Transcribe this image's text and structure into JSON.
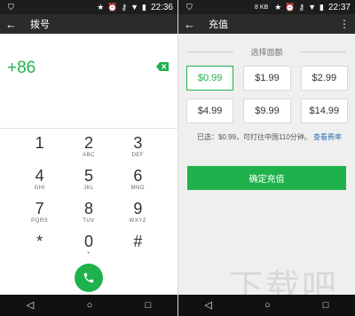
{
  "left": {
    "status": {
      "time": "22:36"
    },
    "appbar": {
      "title": "拨号"
    },
    "number": "+86",
    "keys": [
      {
        "d": "1",
        "l": ""
      },
      {
        "d": "2",
        "l": "ABC"
      },
      {
        "d": "3",
        "l": "DEF"
      },
      {
        "d": "4",
        "l": "GHI"
      },
      {
        "d": "5",
        "l": "JKL"
      },
      {
        "d": "6",
        "l": "MNO"
      },
      {
        "d": "7",
        "l": "PQRS"
      },
      {
        "d": "8",
        "l": "TUV"
      },
      {
        "d": "9",
        "l": "WXYZ"
      },
      {
        "d": "*",
        "l": ""
      },
      {
        "d": "0",
        "l": "+"
      },
      {
        "d": "#",
        "l": ""
      }
    ]
  },
  "right": {
    "status": {
      "time": "22:37",
      "speed": "8 KB"
    },
    "appbar": {
      "title": "充值"
    },
    "section_title": "选择面额",
    "amounts": [
      "$0.99",
      "$1.99",
      "$2.99",
      "$4.99",
      "$9.99",
      "$14.99"
    ],
    "selected_index": 0,
    "info": "已选：$0.99，可打往中国110分钟。",
    "info_link": "查看费率",
    "confirm": "确定充值",
    "watermark": "下载吧"
  },
  "colors": {
    "accent": "#1fb24c",
    "link": "#2b6fb5",
    "appbar": "#2b2b2b"
  },
  "icons": [
    "back-arrow-icon",
    "backspace-icon",
    "phone-icon",
    "more-vert-icon",
    "nav-back-icon",
    "nav-home-icon",
    "nav-recent-icon",
    "wifi-icon",
    "battery-icon",
    "alarm-icon",
    "key-icon",
    "star-icon"
  ]
}
